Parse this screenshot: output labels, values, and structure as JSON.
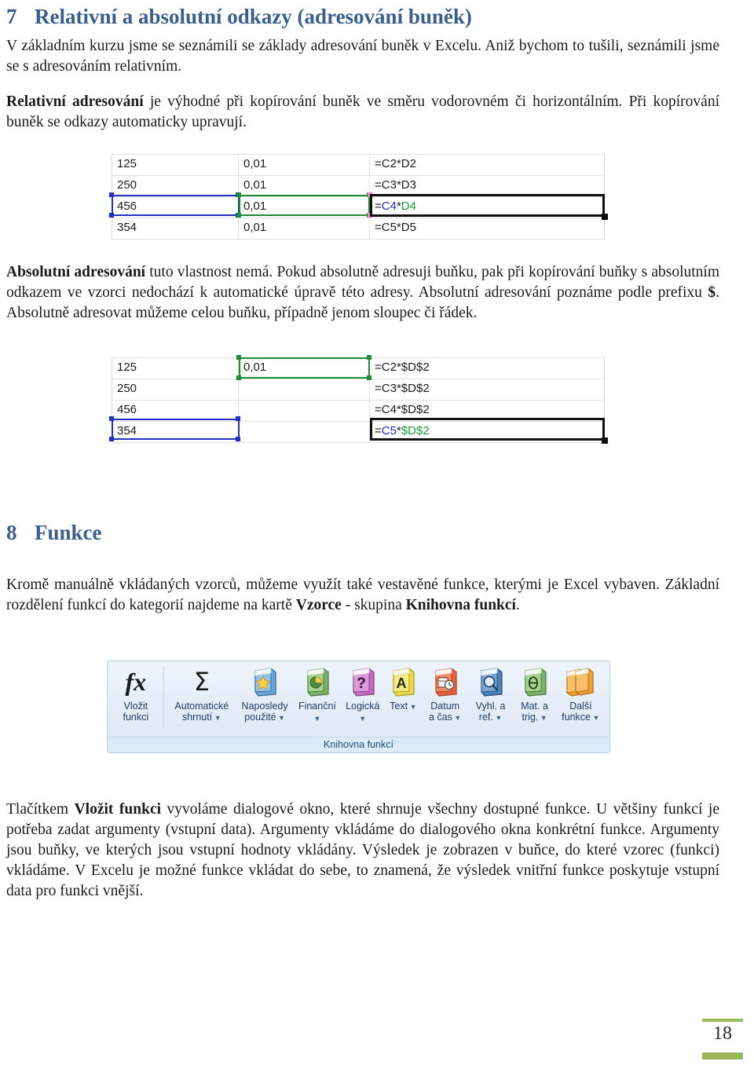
{
  "document": {
    "page_number": "18",
    "heading_color": "#3a5f8c",
    "accent_color": "#9ab959"
  },
  "section7": {
    "number": "7",
    "title": "Relativní a absolutní odkazy (adresování buněk)",
    "para1": "V základním kurzu jsme se seznámili se základy adresování buněk v Excelu. Aniž bychom to tušili, seznámili jsme se s adresováním relativním.",
    "para2_bold": "Relativní adresování",
    "para2_rest": " je výhodné při kopírování buněk ve směru vodorovném či horizontálním. Při kopírování buněk se odkazy automaticky upravují.",
    "para3_bold": "Absolutní adresování",
    "para3_mid": " tuto vlastnost nemá. Pokud absolutně adresuji buňku, pak při kopírování buňky s absolutním odkazem ve vzorci nedochází k automatické úpravě této adresy. Absolutní adresování poznáme podle prefixu ",
    "para3_bold2": "$",
    "para3_end": ". Absolutně adresovat můžeme celou buňku, případně jenom sloupec či řádek."
  },
  "figure_relative": {
    "caption": "relative-reference-spreadsheet",
    "rows": [
      {
        "c1": "125",
        "c2": "0,01",
        "formula_prefix": "=",
        "formula_ref1": "C2",
        "formula_op": "*",
        "formula_ref2": "D2",
        "active": false
      },
      {
        "c1": "250",
        "c2": "0,01",
        "formula_prefix": "=",
        "formula_ref1": "C3",
        "formula_op": "*",
        "formula_ref2": "D3",
        "active": false
      },
      {
        "c1": "456",
        "c2": "0,01",
        "formula_prefix": "=",
        "formula_ref1": "C4",
        "formula_op": "*",
        "formula_ref2": "D4",
        "active": true
      },
      {
        "c1": "354",
        "c2": "0,01",
        "formula_prefix": "=",
        "formula_ref1": "C5",
        "formula_op": "*",
        "formula_ref2": "D5",
        "active": false
      }
    ]
  },
  "figure_absolute": {
    "caption": "absolute-reference-spreadsheet",
    "rows": [
      {
        "c1": "125",
        "c2": "0,01",
        "formula_prefix": "=",
        "formula_ref1": "C2",
        "formula_op": "*",
        "formula_ref2": "$D$2",
        "active": false
      },
      {
        "c1": "250",
        "c2": "",
        "formula_prefix": "=",
        "formula_ref1": "C3",
        "formula_op": "*",
        "formula_ref2": "$D$2",
        "active": false
      },
      {
        "c1": "456",
        "c2": "",
        "formula_prefix": "=",
        "formula_ref1": "C4",
        "formula_op": "*",
        "formula_ref2": "$D$2",
        "active": false
      },
      {
        "c1": "354",
        "c2": "",
        "formula_prefix": "=",
        "formula_ref1": "C5",
        "formula_op": "*",
        "formula_ref2": "$D$2",
        "active": true
      }
    ]
  },
  "section8": {
    "number": "8",
    "title": "Funkce",
    "para1_a": "Kromě manuálně vkládaných vzorců, můžeme využít také vestavěné funkce, kterými je Excel vybaven. Základní rozdělení funkcí do kategorií najdeme na kartě ",
    "para1_b": "Vzorce",
    "para1_c": " - skupina ",
    "para1_d": "Knihovna funkcí",
    "para1_e": ".",
    "para2_a": "Tlačítkem ",
    "para2_b": "Vložit funkci",
    "para2_c": " vyvoláme dialogové okno, které shrnuje všechny dostupné funkce. U většiny funkcí je potřeba zadat argumenty (vstupní data). Argumenty vkládáme do dialogového okna konkrétní funkce. Argumenty jsou buňky, ve kterých jsou vstupní hodnoty vkládány. Výsledek je zobrazen v buňce, do které vzorec (funkci) vkládáme. V Excelu je možné funkce vkládat do sebe, to znamená, že výsledek vnitřní funkce poskytuje vstupní data pro funkci vnější."
  },
  "ribbon": {
    "group_caption": "Knihovna funkcí",
    "items": [
      {
        "label": "Vložit\nfunkci",
        "icon": "fx-icon",
        "has_caret": false,
        "icon_color": "#1b1b1b"
      },
      {
        "label": "Automatické\nshrnutí",
        "icon": "autosum-sigma-icon",
        "has_caret": true,
        "icon_color": "#1b1b1b"
      },
      {
        "label": "Naposledy\npoužité",
        "icon": "book-star-icon",
        "has_caret": true,
        "icon_color": "#5b9bd5"
      },
      {
        "label": "Finanční",
        "icon": "book-financial-icon",
        "has_caret": true,
        "icon_color": "#70ad47"
      },
      {
        "label": "Logická",
        "icon": "book-question-icon",
        "has_caret": true,
        "icon_color": "#c36bbd"
      },
      {
        "label": "Text",
        "icon": "book-text-a-icon",
        "has_caret": true,
        "icon_color": "#f0e24a"
      },
      {
        "label": "Datum\na čas",
        "icon": "book-clock-icon",
        "has_caret": true,
        "icon_color": "#e8603c"
      },
      {
        "label": "Vyhl. a\nref.",
        "icon": "book-search-icon",
        "has_caret": true,
        "icon_color": "#4a7ebb"
      },
      {
        "label": "Mat. a\ntrig.",
        "icon": "book-theta-icon",
        "has_caret": true,
        "icon_color": "#70ad47"
      },
      {
        "label": "Další\nfunkce",
        "icon": "book-stack-icon",
        "has_caret": true,
        "icon_color": "#f0a030"
      }
    ]
  }
}
